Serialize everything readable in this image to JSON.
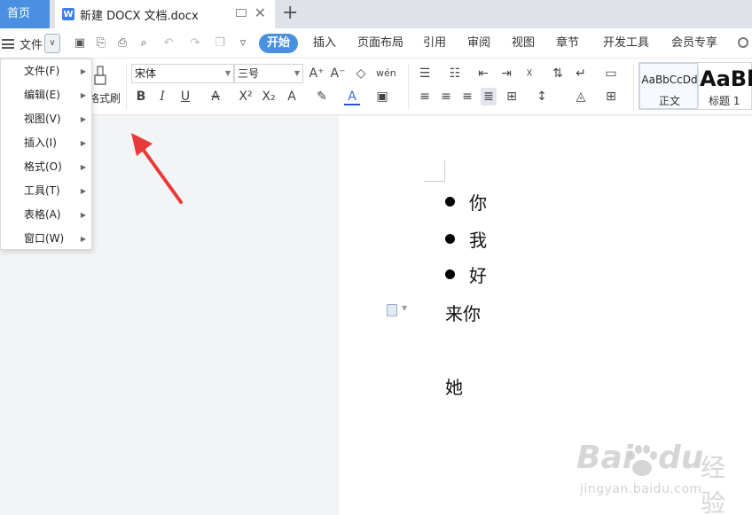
{
  "tabbar": {
    "home_label": "首页",
    "doc_title": "新建 DOCX 文档.docx",
    "doc_icon_letter": "W"
  },
  "toolbar": {
    "menu_label": "文件",
    "ribbon_tabs": [
      "开始",
      "插入",
      "页面布局",
      "引用",
      "审阅",
      "视图",
      "章节",
      "开发工具",
      "会员专享"
    ]
  },
  "ribbon": {
    "format_painter_label": "格式刷",
    "font_name": "宋体",
    "font_size": "三号",
    "styles": [
      {
        "sample": "AaBbCcDd",
        "label": "正文"
      },
      {
        "sample": "AaBb",
        "label": "标题 1"
      }
    ]
  },
  "file_menu": {
    "items": [
      "文件(F)",
      "编辑(E)",
      "视图(V)",
      "插入(I)",
      "格式(O)",
      "工具(T)",
      "表格(A)",
      "窗口(W)"
    ]
  },
  "document": {
    "bullets": [
      "你",
      "我",
      "好"
    ],
    "paragraphs": [
      "来你",
      "她"
    ]
  },
  "watermark": {
    "brand": "Bai",
    "brand2": "du",
    "cn": "经验",
    "url": "jingyan.baidu.com"
  },
  "colors": {
    "accent": "#4a90e2",
    "arrow": "#e83a3a"
  }
}
